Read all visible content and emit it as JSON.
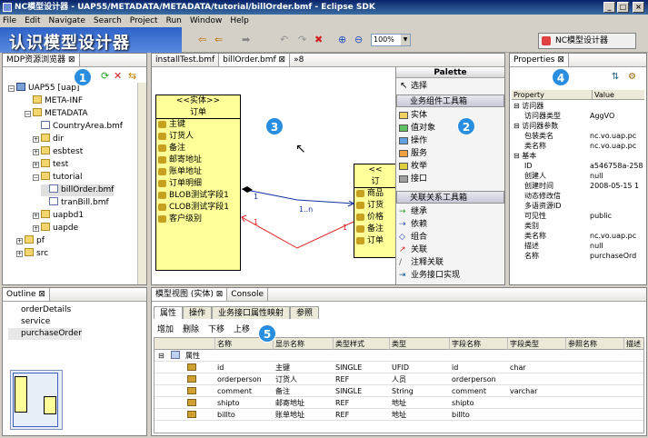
{
  "window": {
    "title": "NC模型设计器 - UAP55/METADATA/METADATA/tutorial/billOrder.bmf - Eclipse SDK",
    "min": "_",
    "max": "□",
    "close": "×"
  },
  "menu": [
    "File",
    "Edit",
    "Navigate",
    "Search",
    "Project",
    "Run",
    "Window",
    "Help"
  ],
  "overlay_title": "认识模型设计器",
  "toolbar": {
    "zoom": "100%"
  },
  "perspective": {
    "label": "NC模型设计器"
  },
  "badges": [
    "1",
    "2",
    "3",
    "4",
    "5"
  ],
  "explorer": {
    "tab": "MDP资源浏览器",
    "items": [
      {
        "label": "UAP55 [uap]",
        "type": "proj",
        "pm": "−"
      },
      {
        "label": "META-INF",
        "type": "folder",
        "pm": ""
      },
      {
        "label": "METADATA",
        "type": "folder",
        "pm": "−"
      },
      {
        "label": "CountryArea.bmf",
        "type": "file",
        "pm": ""
      },
      {
        "label": "dir",
        "type": "folder",
        "pm": "+"
      },
      {
        "label": "esbtest",
        "type": "folder",
        "pm": "+"
      },
      {
        "label": "test",
        "type": "folder",
        "pm": "+"
      },
      {
        "label": "tutorial",
        "type": "folder",
        "pm": "−"
      },
      {
        "label": "billOrder.bmf",
        "type": "file",
        "pm": ""
      },
      {
        "label": "tranBill.bmf",
        "type": "file",
        "pm": ""
      },
      {
        "label": "uapbd1",
        "type": "folder",
        "pm": "+"
      },
      {
        "label": "uapde",
        "type": "folder",
        "pm": "+"
      },
      {
        "label": "pf",
        "type": "folder",
        "pm": "+"
      },
      {
        "label": "src",
        "type": "folder",
        "pm": "+"
      }
    ]
  },
  "outline": {
    "tab": "Outline",
    "items": [
      "orderDetails",
      "service",
      "purchaseOrder"
    ]
  },
  "editor": {
    "tabs": [
      "installTest.bmf",
      "billOrder.bmf",
      "»8"
    ],
    "entity1": {
      "stereotype": "<<实体>>",
      "name": "订单",
      "fields": [
        "主键",
        "订货人",
        "备注",
        "邮寄地址",
        "账单地址",
        "订单明细",
        "BLOB测试字段1",
        "CLOB测试字段1",
        "客户级别"
      ]
    },
    "entity2": {
      "stereotype": "<<",
      "name": "订",
      "fields": [
        "商品",
        "订货",
        "价格",
        "备注",
        "订单"
      ]
    },
    "assoc": {
      "label1": "1",
      "label2": "1..n",
      "label3": "1",
      "label4": "1"
    }
  },
  "palette": {
    "title": "Palette",
    "select": "选择",
    "group1": "业务组件工具箱",
    "items1": [
      "实体",
      "值对象",
      "操作",
      "服务",
      "枚举",
      "接口"
    ],
    "group2": "关联关系工具箱",
    "items2": [
      "继承",
      "依赖",
      "组合",
      "关联",
      "注释关联",
      "业务接口实现"
    ]
  },
  "properties": {
    "tab": "Properties",
    "headers": [
      "Property",
      "Value"
    ],
    "rows": [
      {
        "k": "⊟ 访问器",
        "v": "",
        "ind": 0
      },
      {
        "k": "访问器类型",
        "v": "AggVO",
        "ind": 2
      },
      {
        "k": "⊟ 访问器参数",
        "v": "",
        "ind": 0
      },
      {
        "k": "包装类名",
        "v": "nc.vo.uap.pc",
        "ind": 2
      },
      {
        "k": "类名称",
        "v": "nc.vo.uap.pc",
        "ind": 2
      },
      {
        "k": "⊟ 基本",
        "v": "",
        "ind": 0
      },
      {
        "k": "ID",
        "v": "a546758a-258",
        "ind": 2
      },
      {
        "k": "创建人",
        "v": "null",
        "ind": 2
      },
      {
        "k": "创建时间",
        "v": "2008-05-15 1",
        "ind": 2
      },
      {
        "k": "动态修改信",
        "v": "",
        "ind": 2
      },
      {
        "k": "多语资源ID",
        "v": "",
        "ind": 2
      },
      {
        "k": "可见性",
        "v": "public",
        "ind": 2
      },
      {
        "k": "类别",
        "v": "",
        "ind": 2
      },
      {
        "k": "类名称",
        "v": "nc.vo.uap.pc",
        "ind": 2
      },
      {
        "k": "描述",
        "v": "null",
        "ind": 2
      },
      {
        "k": "名称",
        "v": "purchaseOrd",
        "ind": 2
      }
    ]
  },
  "model_view": {
    "tabs": [
      "模型视图 (实体)",
      "Console"
    ],
    "subtabs": [
      "属性",
      "操作",
      "业务接口属性映射",
      "参照"
    ],
    "actions": [
      "增加",
      "删除",
      "下移",
      "上移"
    ],
    "columns": [
      "名称",
      "显示名称",
      "类型样式",
      "类型",
      "字段名称",
      "字段类型",
      "参照名称",
      "描述"
    ],
    "group": "属性",
    "rows": [
      [
        "id",
        "主键",
        "SINGLE",
        "UFID",
        "id",
        "char",
        ""
      ],
      [
        "orderperson",
        "订货人",
        "REF",
        "人员",
        "orderperson",
        "",
        ""
      ],
      [
        "comment",
        "备注",
        "SINGLE",
        "String",
        "comment",
        "varchar",
        ""
      ],
      [
        "shipto",
        "邮寄地址",
        "REF",
        "地址",
        "shipto",
        "",
        ""
      ],
      [
        "billto",
        "账单地址",
        "REF",
        "地址",
        "billto",
        "",
        ""
      ]
    ]
  }
}
